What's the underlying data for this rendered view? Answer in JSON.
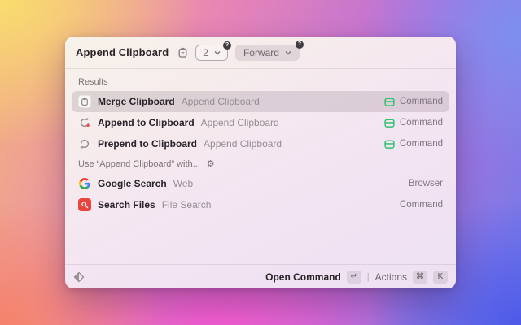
{
  "header": {
    "title": "Append Clipboard",
    "count_dropdown": {
      "value": "2",
      "help_badge": "?"
    },
    "mode_dropdown": {
      "value": "Forward",
      "help_badge": "?"
    }
  },
  "sections": [
    {
      "label": "Results",
      "rows": [
        {
          "title": "Merge Clipboard",
          "subtitle": "Append Clipboard",
          "accessory": "Command",
          "selected": true
        },
        {
          "title": "Append to Clipboard",
          "subtitle": "Append Clipboard",
          "accessory": "Command",
          "selected": false
        },
        {
          "title": "Prepend to Clipboard",
          "subtitle": "Append Clipboard",
          "accessory": "Command",
          "selected": false
        }
      ]
    },
    {
      "label": "Use “Append Clipboard” with...",
      "rows": [
        {
          "title": "Google Search",
          "subtitle": "Web",
          "accessory": "Browser",
          "selected": false
        },
        {
          "title": "Search Files",
          "subtitle": "File Search",
          "accessory": "Command",
          "selected": false
        }
      ]
    }
  ],
  "footer": {
    "open_command_label": "Open Command",
    "enter_key": "↵",
    "divider": "|",
    "actions_label": "Actions",
    "cmd_key": "⌘",
    "k_key": "K"
  },
  "icons": {
    "header_icon": "clipboard-icon",
    "merge_row_icon": "clipboard-badge-icon",
    "append_row_icon": "append-clipboard-icon",
    "prepend_row_icon": "prepend-clipboard-icon",
    "google_row_icon": "google-g-icon",
    "search_files_row_icon": "file-search-icon",
    "command_accessory_icon": "command-window-icon",
    "section_gear": "gear-icon",
    "footer_logo": "raycast-diamond-icon"
  },
  "colors": {
    "accent_green": "#2fc26f",
    "search_files_red": "#e8453c",
    "selection_overlay": "rgba(96,78,94,0.17)",
    "google": [
      "#EA4335",
      "#4285F4",
      "#FBBC05",
      "#34A853"
    ]
  }
}
